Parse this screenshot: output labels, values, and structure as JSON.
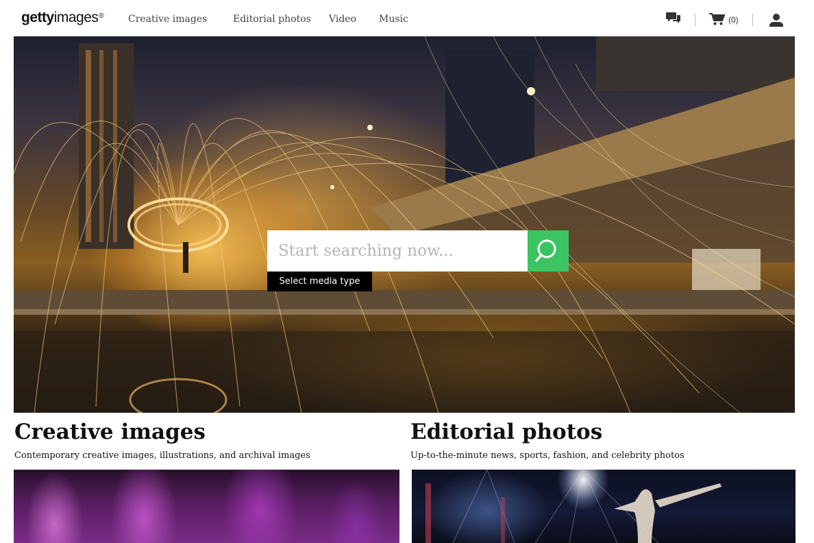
{
  "header": {
    "logo": {
      "bold": "getty",
      "light": "images",
      "mark": "®"
    },
    "nav": [
      {
        "label": "Creative images"
      },
      {
        "label": "Editorial photos"
      },
      {
        "label": "Video"
      },
      {
        "label": "Music"
      }
    ],
    "icons": [
      "chat-icon",
      "cart-icon",
      "user-icon"
    ],
    "cart_count": "(0)"
  },
  "hero": {
    "search_placeholder": "Start searching now...",
    "search_icon": "search-icon",
    "media_type_label": "Select media type",
    "accent": "#3ac562"
  },
  "sections": [
    {
      "title": "Creative images",
      "subtitle": "Contemporary creative images, illustrations, and archival images"
    },
    {
      "title": "Editorial photos",
      "subtitle": "Up-to-the-minute news, sports, fashion, and celebrity photos"
    }
  ]
}
